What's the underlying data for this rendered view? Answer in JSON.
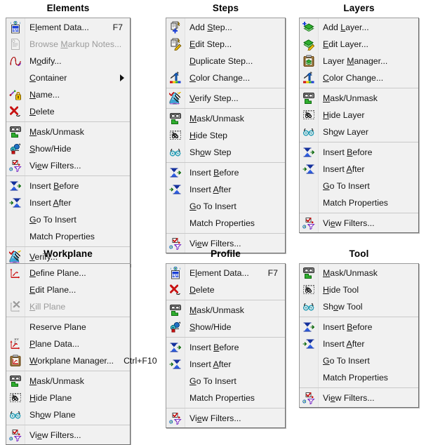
{
  "menus": [
    {
      "id": "elements",
      "title": "Elements",
      "column": 1,
      "row": 1,
      "items": [
        {
          "icon": "element-data-icon",
          "label": "Element Data...",
          "mnemonic": "l",
          "accel": "F7",
          "disabled": false,
          "submenu": false
        },
        {
          "icon": "browse-markup-notes-icon",
          "label": "Browse Markup Notes...",
          "mnemonic": "M",
          "accel": "",
          "disabled": true,
          "submenu": false
        },
        {
          "icon": "modify-icon",
          "label": "Modify...",
          "mnemonic": "o",
          "accel": "",
          "disabled": false,
          "submenu": false
        },
        {
          "icon": "",
          "label": "Container",
          "mnemonic": "C",
          "accel": "",
          "disabled": false,
          "submenu": true
        },
        {
          "icon": "name-icon",
          "label": "Name...",
          "mnemonic": "N",
          "accel": "",
          "disabled": false,
          "submenu": false
        },
        {
          "icon": "delete-icon",
          "label": "Delete",
          "mnemonic": "D",
          "accel": "",
          "disabled": false,
          "submenu": false
        },
        {
          "separator": true
        },
        {
          "icon": "mask-unmask-icon",
          "label": "Mask/Unmask",
          "mnemonic": "M",
          "accel": "",
          "disabled": false,
          "submenu": false
        },
        {
          "icon": "show-hide-icon",
          "label": "Show/Hide",
          "mnemonic": "S",
          "accel": "",
          "disabled": false,
          "submenu": false
        },
        {
          "icon": "view-filters-icon",
          "label": "View Filters...",
          "mnemonic": "e",
          "accel": "",
          "disabled": false,
          "submenu": false
        },
        {
          "separator": true
        },
        {
          "icon": "insert-before-icon",
          "label": "Insert Before",
          "mnemonic": "B",
          "accel": "",
          "disabled": false,
          "submenu": false
        },
        {
          "icon": "insert-after-icon",
          "label": "Insert After",
          "mnemonic": "A",
          "accel": "",
          "disabled": false,
          "submenu": false
        },
        {
          "icon": "",
          "label": "Go To Insert",
          "mnemonic": "G",
          "accel": "",
          "disabled": false,
          "submenu": false
        },
        {
          "icon": "",
          "label": "Match Properties",
          "mnemonic": "",
          "accel": "",
          "disabled": false,
          "submenu": false
        },
        {
          "separator": true
        },
        {
          "icon": "verify-icon",
          "label": "Verify...",
          "mnemonic": "V",
          "accel": "",
          "disabled": false,
          "submenu": false
        }
      ]
    },
    {
      "id": "steps",
      "title": "Steps",
      "column": 2,
      "row": 1,
      "items": [
        {
          "icon": "add-step-icon",
          "label": "Add Step...",
          "mnemonic": "S",
          "accel": "",
          "disabled": false,
          "submenu": false
        },
        {
          "icon": "edit-step-icon",
          "label": "Edit Step...",
          "mnemonic": "E",
          "accel": "",
          "disabled": false,
          "submenu": false
        },
        {
          "icon": "",
          "label": "Duplicate Step...",
          "mnemonic": "D",
          "accel": "",
          "disabled": false,
          "submenu": false
        },
        {
          "icon": "color-change-icon",
          "label": "Color Change...",
          "mnemonic": "C",
          "accel": "",
          "disabled": false,
          "submenu": false
        },
        {
          "separator": true
        },
        {
          "icon": "verify-icon",
          "label": "Verify Step...",
          "mnemonic": "V",
          "accel": "",
          "disabled": false,
          "submenu": false
        },
        {
          "separator": true
        },
        {
          "icon": "mask-unmask-icon",
          "label": "Mask/Unmask",
          "mnemonic": "M",
          "accel": "",
          "disabled": false,
          "submenu": false
        },
        {
          "icon": "hide-icon",
          "label": "Hide Step",
          "mnemonic": "H",
          "accel": "",
          "disabled": false,
          "submenu": false
        },
        {
          "icon": "show-icon",
          "label": "Show Step",
          "mnemonic": "o",
          "accel": "",
          "disabled": false,
          "submenu": false
        },
        {
          "separator": true
        },
        {
          "icon": "insert-before-icon",
          "label": "Insert Before",
          "mnemonic": "B",
          "accel": "",
          "disabled": false,
          "submenu": false
        },
        {
          "icon": "insert-after-icon",
          "label": "Insert After",
          "mnemonic": "A",
          "accel": "",
          "disabled": false,
          "submenu": false
        },
        {
          "icon": "",
          "label": "Go To Insert",
          "mnemonic": "G",
          "accel": "",
          "disabled": false,
          "submenu": false
        },
        {
          "icon": "",
          "label": "Match Properties",
          "mnemonic": "",
          "accel": "",
          "disabled": false,
          "submenu": false
        },
        {
          "separator": true
        },
        {
          "icon": "view-filters-icon",
          "label": "View Filters...",
          "mnemonic": "e",
          "accel": "",
          "disabled": false,
          "submenu": false
        }
      ]
    },
    {
      "id": "layers",
      "title": "Layers",
      "column": 3,
      "row": 1,
      "items": [
        {
          "icon": "add-layer-icon",
          "label": "Add Layer...",
          "mnemonic": "L",
          "accel": "",
          "disabled": false,
          "submenu": false
        },
        {
          "icon": "edit-layer-icon",
          "label": "Edit Layer...",
          "mnemonic": "E",
          "accel": "",
          "disabled": false,
          "submenu": false
        },
        {
          "icon": "layer-manager-icon",
          "label": "Layer Manager...",
          "mnemonic": "M",
          "accel": "",
          "disabled": false,
          "submenu": false
        },
        {
          "icon": "color-change-icon",
          "label": "Color Change...",
          "mnemonic": "C",
          "accel": "",
          "disabled": false,
          "submenu": false
        },
        {
          "separator": true
        },
        {
          "icon": "mask-unmask-icon",
          "label": "Mask/Unmask",
          "mnemonic": "M",
          "accel": "",
          "disabled": false,
          "submenu": false
        },
        {
          "icon": "hide-icon",
          "label": "Hide Layer",
          "mnemonic": "H",
          "accel": "",
          "disabled": false,
          "submenu": false
        },
        {
          "icon": "show-icon",
          "label": "Show Layer",
          "mnemonic": "o",
          "accel": "",
          "disabled": false,
          "submenu": false
        },
        {
          "separator": true
        },
        {
          "icon": "insert-before-icon",
          "label": "Insert Before",
          "mnemonic": "B",
          "accel": "",
          "disabled": false,
          "submenu": false
        },
        {
          "icon": "insert-after-icon",
          "label": "Insert After",
          "mnemonic": "A",
          "accel": "",
          "disabled": false,
          "submenu": false
        },
        {
          "icon": "",
          "label": "Go To Insert",
          "mnemonic": "G",
          "accel": "",
          "disabled": false,
          "submenu": false
        },
        {
          "icon": "",
          "label": "Match Properties",
          "mnemonic": "",
          "accel": "",
          "disabled": false,
          "submenu": false
        },
        {
          "separator": true
        },
        {
          "icon": "view-filters-icon",
          "label": "View Filters...",
          "mnemonic": "e",
          "accel": "",
          "disabled": false,
          "submenu": false
        }
      ]
    },
    {
      "id": "workplane",
      "title": "Workplane",
      "column": 1,
      "row": 2,
      "items": [
        {
          "icon": "define-plane-icon",
          "label": "Define Plane...",
          "mnemonic": "D",
          "accel": "",
          "disabled": false,
          "submenu": false
        },
        {
          "icon": "",
          "label": "Edit Plane...",
          "mnemonic": "E",
          "accel": "",
          "disabled": false,
          "submenu": false
        },
        {
          "icon": "kill-plane-icon",
          "label": "Kill Plane",
          "mnemonic": "K",
          "accel": "",
          "disabled": true,
          "submenu": false
        },
        {
          "separator": true
        },
        {
          "icon": "",
          "label": "Reserve Plane",
          "mnemonic": "",
          "accel": "",
          "disabled": false,
          "submenu": false
        },
        {
          "icon": "plane-data-icon",
          "label": "Plane Data...",
          "mnemonic": "P",
          "accel": "",
          "disabled": false,
          "submenu": false
        },
        {
          "icon": "workplane-manager-icon",
          "label": "Workplane Manager...",
          "mnemonic": "W",
          "accel": "Ctrl+F10",
          "disabled": false,
          "submenu": false
        },
        {
          "separator": true
        },
        {
          "icon": "mask-unmask-icon",
          "label": "Mask/Unmask",
          "mnemonic": "M",
          "accel": "",
          "disabled": false,
          "submenu": false
        },
        {
          "icon": "hide-icon",
          "label": "Hide Plane",
          "mnemonic": "H",
          "accel": "",
          "disabled": false,
          "submenu": false
        },
        {
          "icon": "show-icon",
          "label": "Show Plane",
          "mnemonic": "o",
          "accel": "",
          "disabled": false,
          "submenu": false
        },
        {
          "separator": true
        },
        {
          "icon": "view-filters-icon",
          "label": "View Filters...",
          "mnemonic": "e",
          "accel": "",
          "disabled": false,
          "submenu": false
        }
      ]
    },
    {
      "id": "profile",
      "title": "Profile",
      "column": 2,
      "row": 2,
      "items": [
        {
          "icon": "element-data-icon",
          "label": "Element Data...",
          "mnemonic": "l",
          "accel": "F7",
          "disabled": false,
          "submenu": false
        },
        {
          "icon": "delete-icon",
          "label": "Delete",
          "mnemonic": "D",
          "accel": "",
          "disabled": false,
          "submenu": false
        },
        {
          "separator": true
        },
        {
          "icon": "mask-unmask-icon",
          "label": "Mask/Unmask",
          "mnemonic": "M",
          "accel": "",
          "disabled": false,
          "submenu": false
        },
        {
          "icon": "show-hide-icon",
          "label": "Show/Hide",
          "mnemonic": "S",
          "accel": "",
          "disabled": false,
          "submenu": false
        },
        {
          "separator": true
        },
        {
          "icon": "insert-before-icon",
          "label": "Insert Before",
          "mnemonic": "B",
          "accel": "",
          "disabled": false,
          "submenu": false
        },
        {
          "icon": "insert-after-icon",
          "label": "Insert After",
          "mnemonic": "A",
          "accel": "",
          "disabled": false,
          "submenu": false
        },
        {
          "icon": "",
          "label": "Go To Insert",
          "mnemonic": "G",
          "accel": "",
          "disabled": false,
          "submenu": false
        },
        {
          "icon": "",
          "label": "Match Properties",
          "mnemonic": "",
          "accel": "",
          "disabled": false,
          "submenu": false
        },
        {
          "separator": true
        },
        {
          "icon": "view-filters-icon",
          "label": "View Filters...",
          "mnemonic": "e",
          "accel": "",
          "disabled": false,
          "submenu": false
        }
      ]
    },
    {
      "id": "tool",
      "title": "Tool",
      "column": 3,
      "row": 2,
      "items": [
        {
          "icon": "mask-unmask-icon",
          "label": "Mask/Unmask",
          "mnemonic": "M",
          "accel": "",
          "disabled": false,
          "submenu": false
        },
        {
          "icon": "hide-icon",
          "label": "Hide Tool",
          "mnemonic": "H",
          "accel": "",
          "disabled": false,
          "submenu": false
        },
        {
          "icon": "show-icon",
          "label": "Show Tool",
          "mnemonic": "o",
          "accel": "",
          "disabled": false,
          "submenu": false
        },
        {
          "separator": true
        },
        {
          "icon": "insert-before-icon",
          "label": "Insert Before",
          "mnemonic": "B",
          "accel": "",
          "disabled": false,
          "submenu": false
        },
        {
          "icon": "insert-after-icon",
          "label": "Insert After",
          "mnemonic": "A",
          "accel": "",
          "disabled": false,
          "submenu": false
        },
        {
          "icon": "",
          "label": "Go To Insert",
          "mnemonic": "G",
          "accel": "",
          "disabled": false,
          "submenu": false
        },
        {
          "icon": "",
          "label": "Match Properties",
          "mnemonic": "",
          "accel": "",
          "disabled": false,
          "submenu": false
        },
        {
          "separator": true
        },
        {
          "icon": "view-filters-icon",
          "label": "View Filters...",
          "mnemonic": "e",
          "accel": "",
          "disabled": false,
          "submenu": false
        }
      ]
    }
  ],
  "colors": {
    "menu_background": "#f1f1f1",
    "menu_border": "#9a9a9a",
    "separator": "#c9c9c9",
    "text": "#141414",
    "text_disabled": "#9b9b9b",
    "icon_blue": "#1a3fd8",
    "icon_green": "#2f9e2f",
    "icon_red": "#cc1111",
    "icon_yellow": "#f2c200",
    "page_background": "#ffffff"
  }
}
